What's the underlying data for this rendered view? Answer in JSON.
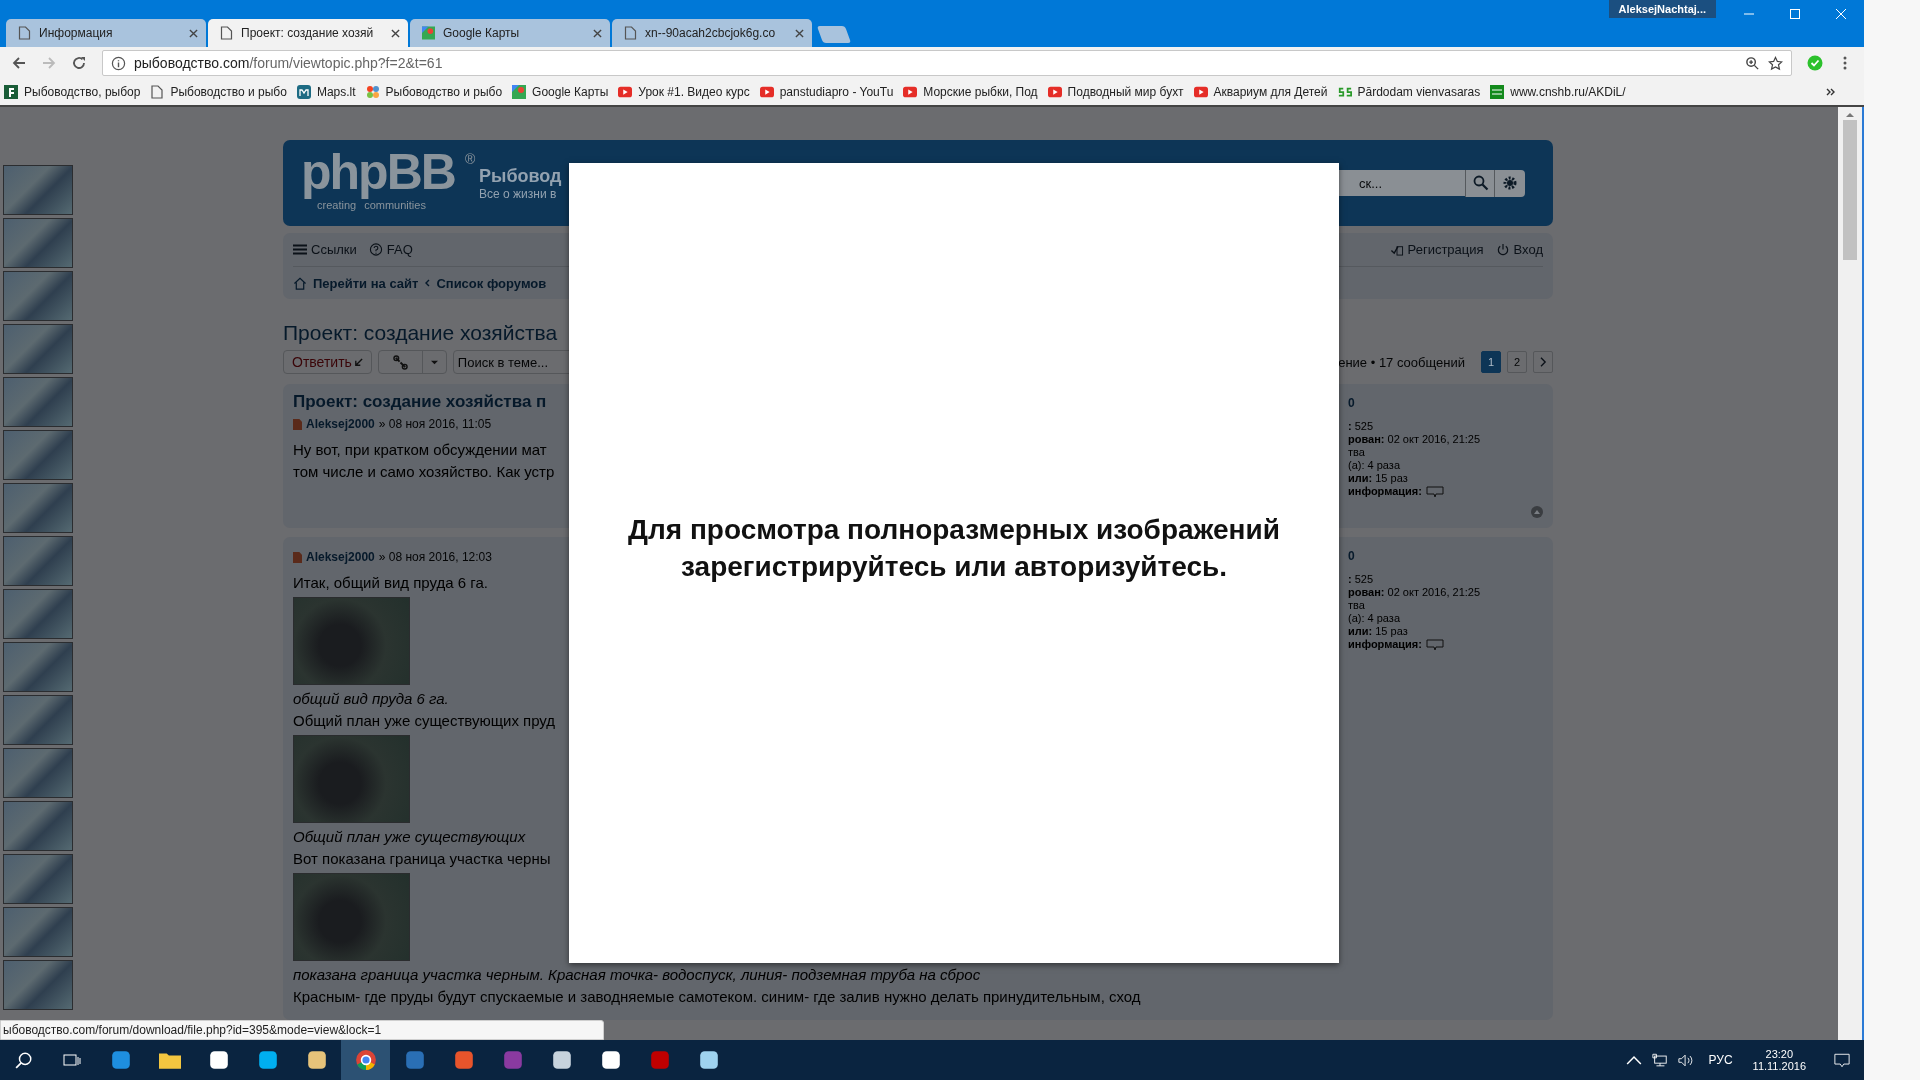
{
  "browser": {
    "tabs": [
      {
        "title": "Информация",
        "kind": "page",
        "selected": false
      },
      {
        "title": "Проект: создание хозяй",
        "kind": "page",
        "selected": true
      },
      {
        "title": "Google Карты",
        "kind": "maps",
        "selected": false
      },
      {
        "title": "xn--90acah2cbcjok6g.co",
        "kind": "page",
        "selected": false
      }
    ],
    "profile": "AleksejNachtaj...",
    "address": {
      "host": "рыбоводство.com",
      "path": "/forum/viewtopic.php?f=2&t=61"
    },
    "bookmarks": [
      {
        "label": "Рыбоводство, рыбор",
        "kind": "square"
      },
      {
        "label": "Рыбоводство и рыбо",
        "kind": "page"
      },
      {
        "label": "Maps.lt",
        "kind": "teal"
      },
      {
        "label": "Рыбоводство и рыбо",
        "kind": "flower"
      },
      {
        "label": "Google Карты",
        "kind": "maps"
      },
      {
        "label": "Урок #1. Видео курс",
        "kind": "video"
      },
      {
        "label": "panstudiapro - YouTu",
        "kind": "video"
      },
      {
        "label": "Морские рыбки, Под",
        "kind": "video"
      },
      {
        "label": "Подводный мир бухт",
        "kind": "video"
      },
      {
        "label": "Аквариум для Детей",
        "kind": "video"
      },
      {
        "label": "Pārdodam vienvasaras",
        "kind": "squiggle"
      },
      {
        "label": "www.cnshb.ru/AKDiL/",
        "kind": "green"
      }
    ]
  },
  "forum": {
    "logo": {
      "name": "phpBB",
      "mark": "®",
      "tagline_1": "creating",
      "tagline_2": "communities"
    },
    "site_title": "Рыбовод",
    "site_description": "Все о жизни в",
    "search": {
      "placeholder": "ск..."
    },
    "nav_links": [
      {
        "label": "Ссылки",
        "kind": "menu"
      },
      {
        "label": "FAQ",
        "kind": "help"
      }
    ],
    "user_links": [
      {
        "label": "Регистрация",
        "kind": "register"
      },
      {
        "label": "Вход",
        "kind": "power"
      }
    ],
    "breadcrumbs": [
      "Перейти на сайт",
      "Список форумов"
    ],
    "topic_title": "Проект: создание хозяйства",
    "reply_button": "Ответить",
    "topic_search": {
      "placeholder": "Поиск в теме..."
    },
    "stats": "ение • 17 сообщений",
    "pages": [
      {
        "label": "1",
        "selected": true
      },
      {
        "label": "2",
        "selected": false
      }
    ],
    "posts": [
      {
        "title": "Проект: создание хозяйства п",
        "author": "Aleksej2000",
        "date": "» 08 ноя 2016, 11:05",
        "back_to_top": true,
        "content": [
          {
            "kind": "text",
            "text": "Ну вот, при кратком обсуждении мат"
          },
          {
            "kind": "text",
            "text": "том числе и само хозяйство. Как устр"
          }
        ],
        "profile_name": "0",
        "profile": [
          {
            "kind": "line",
            "text": "**:** 525"
          },
          {
            "kind": "line",
            "text": "**рован:** 02 окт 2016, 21:25"
          },
          {
            "kind": "line",
            "text": "тва"
          },
          {
            "kind": "line",
            "text": "(а): 4 раза"
          },
          {
            "kind": "line",
            "text": "**или:** 15 раз"
          },
          {
            "kind": "contact",
            "text": "**информация:**"
          }
        ]
      },
      {
        "author": "Aleksej2000",
        "date": "» 08 ноя 2016, 12:03",
        "content": [
          {
            "kind": "text",
            "text": "Итак, общий вид пруда 6 га."
          },
          {
            "kind": "image"
          },
          {
            "kind": "caption",
            "text": "общий вид пруда 6 га."
          },
          {
            "kind": "text",
            "text": "Общий план уже существующих пруд"
          },
          {
            "kind": "image"
          },
          {
            "kind": "caption",
            "text": "Общий план уже существующих"
          },
          {
            "kind": "text",
            "text": "Вот показана граница участка черны"
          },
          {
            "kind": "image"
          },
          {
            "kind": "caption",
            "text": "показана граница участка черным. Красная точка- водоспуск, линия- подземная труба на сброс"
          },
          {
            "kind": "text",
            "text": "Красным- где пруды будут спускаемые и заводняемые самотеком. синим- где залив нужно делать принудительным, сход"
          }
        ],
        "profile_name": "0",
        "profile": [
          {
            "kind": "line",
            "text": "**:** 525"
          },
          {
            "kind": "line",
            "text": "**рован:** 02 окт 2016, 21:25"
          },
          {
            "kind": "line",
            "text": "тва"
          },
          {
            "kind": "line",
            "text": "(а): 4 раза"
          },
          {
            "kind": "line",
            "text": "**или:** 15 раз"
          },
          {
            "kind": "contact",
            "text": "**информация:**"
          }
        ]
      }
    ]
  },
  "modal": {
    "message": "Для просмотра полноразмерных изображений зарегистрируйтесь или авторизуйтесь."
  },
  "status_url": "ыбоводство.com/forum/download/file.php?id=395&mode=view&lock=1",
  "taskbar": {
    "apps": [
      {
        "kind": "edge",
        "active": false
      },
      {
        "kind": "folder",
        "active": false
      },
      {
        "kind": "store",
        "active": false
      },
      {
        "kind": "skype",
        "active": false
      },
      {
        "kind": "paint",
        "active": false
      },
      {
        "kind": "chrome",
        "active": true
      },
      {
        "kind": "mail",
        "active": false
      },
      {
        "kind": "pinwheel",
        "active": false
      },
      {
        "kind": "archive",
        "active": false
      },
      {
        "kind": "monitor",
        "active": false
      },
      {
        "kind": "photo",
        "active": false
      },
      {
        "kind": "ftp",
        "active": false
      },
      {
        "kind": "notepad",
        "active": false
      }
    ],
    "language": "РУС",
    "time": "23:20",
    "date": "11.11.2016"
  }
}
